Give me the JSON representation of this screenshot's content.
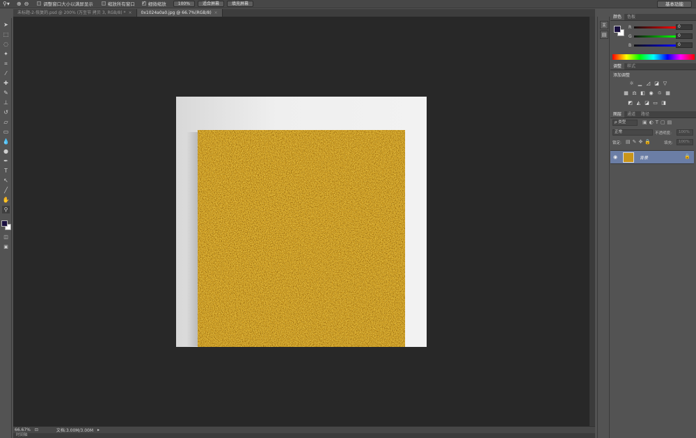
{
  "option_bar": {
    "zoom_tool_icon": "zoom-icon",
    "resize_windows_label": "调整窗口大小以满屏显示",
    "zoom_all_windows_label": "缩放所有窗口",
    "scrubby_zoom_label": "细微缩放",
    "scrubby_zoom_checked": true,
    "btn_100": "100%",
    "btn_fit": "适合屏幕",
    "btn_fill": "填充屏幕",
    "workspace": "基本功能"
  },
  "tabs": [
    {
      "label": "未标题-2-恢复的.psd @ 200% (万至节 拷贝 3, RGB/8) *",
      "active": false
    },
    {
      "label": "0x1024a0a0.jpg @ 66.7%(RGB/8)",
      "active": true
    }
  ],
  "status": {
    "zoom": "66.67%",
    "doc": "文档:3.00M/3.00M",
    "timeline": "时间轴"
  },
  "color_panel": {
    "tabs": [
      "颜色",
      "色板"
    ],
    "channels": [
      {
        "label": "R",
        "value": "0"
      },
      {
        "label": "G",
        "value": "0"
      },
      {
        "label": "B",
        "value": "0"
      }
    ],
    "foreground": "#1a1040",
    "background": "#ffffff"
  },
  "adjustments_panel": {
    "tabs": [
      "调整",
      "样式"
    ],
    "add_label": "添加调整"
  },
  "layers_panel": {
    "tabs": [
      "图层",
      "通道",
      "路径"
    ],
    "filter_label": "ρ 类型",
    "blend_mode": "正常",
    "opacity_label": "不透明度:",
    "opacity_value": "100%",
    "lock_label": "锁定:",
    "fill_label": "填充:",
    "fill_value": "100%",
    "layers": [
      {
        "name": "背景",
        "visible": true,
        "locked": true
      }
    ]
  },
  "colors": {
    "gold_base": "#c9951b",
    "canvas_bg": "#282828",
    "chrome": "#535353"
  }
}
